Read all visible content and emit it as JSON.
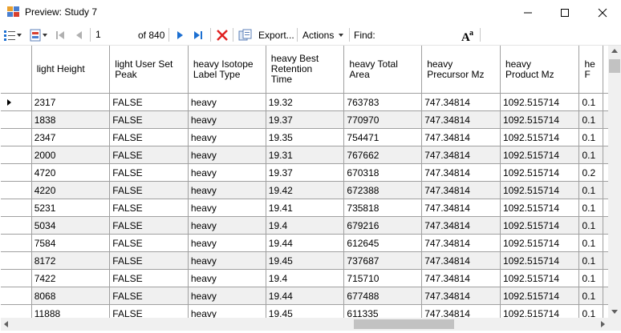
{
  "window": {
    "title": "Preview: Study 7"
  },
  "toolbar": {
    "position": "1",
    "of_label": "of 840",
    "export_label": "Export...",
    "actions_label": "Actions",
    "find_label": "Find:",
    "find_value": ""
  },
  "table": {
    "columns": [
      "light Height",
      "light User Set\nPeak",
      "heavy Isotope\nLabel Type",
      "heavy Best\nRetention\nTime",
      "heavy Total\nArea",
      "heavy\nPrecursor Mz",
      "heavy\nProduct Mz",
      "he\nF"
    ],
    "rows": [
      [
        "2317",
        "FALSE",
        "heavy",
        "19.32",
        "763783",
        "747.34814",
        "1092.515714",
        "0.1"
      ],
      [
        "1838",
        "FALSE",
        "heavy",
        "19.37",
        "770970",
        "747.34814",
        "1092.515714",
        "0.1"
      ],
      [
        "2347",
        "FALSE",
        "heavy",
        "19.35",
        "754471",
        "747.34814",
        "1092.515714",
        "0.1"
      ],
      [
        "2000",
        "FALSE",
        "heavy",
        "19.31",
        "767662",
        "747.34814",
        "1092.515714",
        "0.1"
      ],
      [
        "4720",
        "FALSE",
        "heavy",
        "19.37",
        "670318",
        "747.34814",
        "1092.515714",
        "0.2"
      ],
      [
        "4220",
        "FALSE",
        "heavy",
        "19.42",
        "672388",
        "747.34814",
        "1092.515714",
        "0.1"
      ],
      [
        "5231",
        "FALSE",
        "heavy",
        "19.41",
        "735818",
        "747.34814",
        "1092.515714",
        "0.1"
      ],
      [
        "5034",
        "FALSE",
        "heavy",
        "19.4",
        "679216",
        "747.34814",
        "1092.515714",
        "0.1"
      ],
      [
        "7584",
        "FALSE",
        "heavy",
        "19.44",
        "612645",
        "747.34814",
        "1092.515714",
        "0.1"
      ],
      [
        "8172",
        "FALSE",
        "heavy",
        "19.45",
        "737687",
        "747.34814",
        "1092.515714",
        "0.1"
      ],
      [
        "7422",
        "FALSE",
        "heavy",
        "19.4",
        "715710",
        "747.34814",
        "1092.515714",
        "0.1"
      ],
      [
        "8068",
        "FALSE",
        "heavy",
        "19.44",
        "677488",
        "747.34814",
        "1092.515714",
        "0.1"
      ],
      [
        "11888",
        "FALSE",
        "heavy",
        "19.45",
        "611335",
        "747.34814",
        "1092.515714",
        "0.1"
      ]
    ],
    "current_row_index": 0
  },
  "colors": {
    "nav_blue": "#1c6fd1",
    "delete_red": "#e02020",
    "grid_line": "#a0a0a0",
    "alt_row": "#f0f0f0"
  },
  "icons": [
    "app-icon",
    "view-options-icon",
    "dropdown-arrow-icon",
    "report-icon",
    "first-record-icon",
    "previous-record-icon",
    "next-record-icon",
    "last-record-icon",
    "delete-icon",
    "copy-icon",
    "font-size-icon",
    "minimize-icon",
    "maximize-icon",
    "close-icon"
  ]
}
